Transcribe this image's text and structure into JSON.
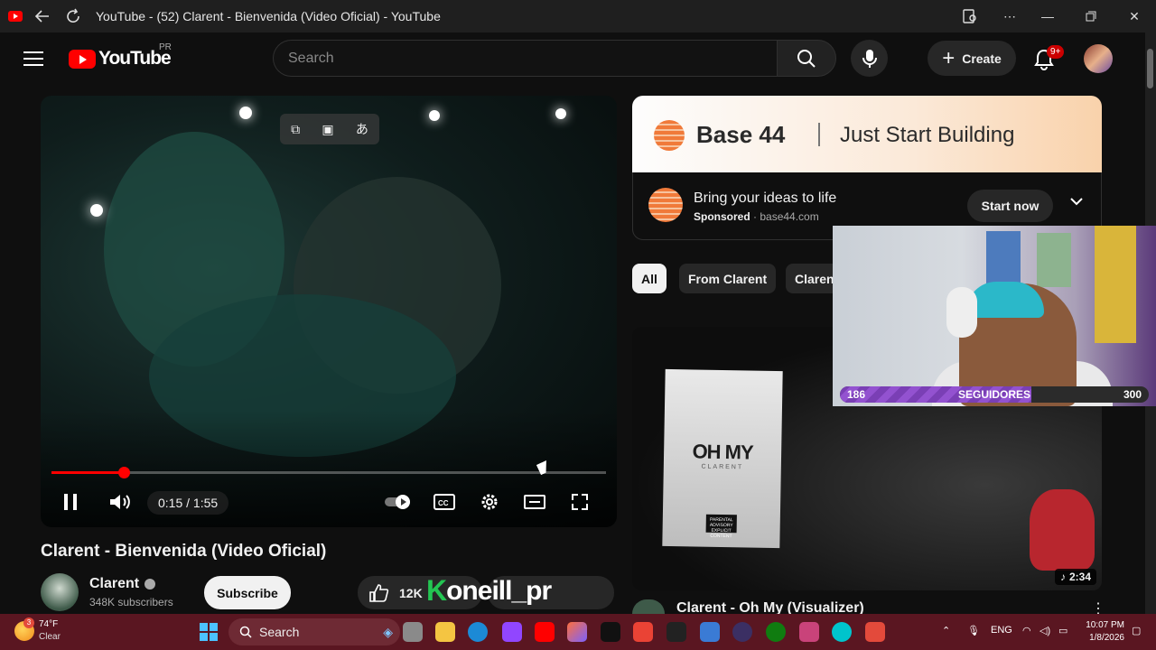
{
  "window": {
    "title": "YouTube - (52) Clarent - Bienvenida (Video Oficial) - YouTube"
  },
  "header": {
    "logo_text": "YouTube",
    "region": "PR",
    "search_placeholder": "Search",
    "create_label": "Create",
    "notifications_badge": "9+"
  },
  "player": {
    "time": "0:15 / 1:55",
    "progress_fraction": 0.13
  },
  "video": {
    "title": "Clarent - Bienvenida (Video Oficial)",
    "channel": "Clarent",
    "subscribers": "348K subscribers",
    "subscribe_label": "Subscribe",
    "likes": "12K"
  },
  "watermark": {
    "k": "K",
    "text": "oneill_pr"
  },
  "ad": {
    "brand": "Base 44",
    "tagline": "Just Start Building",
    "headline": "Bring your ideas to life",
    "sponsored": "Sponsored",
    "domain": "base44.com",
    "cta": "Start now",
    "accent": "#f07a3a"
  },
  "chips": [
    {
      "label": "All",
      "active": true
    },
    {
      "label": "From Clarent",
      "active": false
    },
    {
      "label": "Claren",
      "active": false
    }
  ],
  "recommended": {
    "cover_title": "OH MY",
    "cover_artist": "CLARENT",
    "cover_advisory": "PARENTAL ADVISORY EXPLICIT CONTENT",
    "duration": "2:34",
    "title": "Clarent - Oh My (Visualizer)"
  },
  "overlay": {
    "followers_current": "186",
    "followers_label": "SEGUIDORES",
    "followers_goal": "300",
    "followers_fraction": 0.62
  },
  "taskbar": {
    "weather_temp": "74°F",
    "weather_cond": "Clear",
    "weather_badge": "3",
    "search_label": "Search",
    "language": "ENG",
    "time": "10:07 PM",
    "date": "1/8/2026"
  }
}
